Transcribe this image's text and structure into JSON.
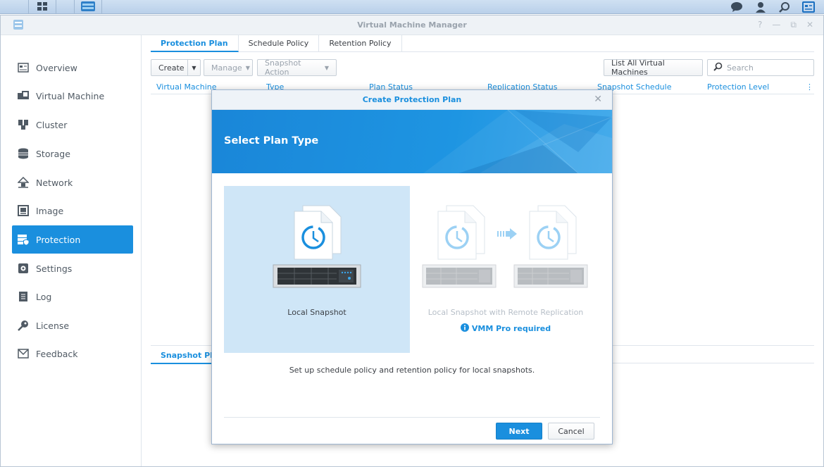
{
  "window": {
    "title": "Virtual Machine Manager"
  },
  "sidebar": {
    "items": [
      {
        "label": "Overview",
        "icon": "overview-icon"
      },
      {
        "label": "Virtual Machine",
        "icon": "virtual-machine-icon"
      },
      {
        "label": "Cluster",
        "icon": "cluster-icon"
      },
      {
        "label": "Storage",
        "icon": "storage-icon"
      },
      {
        "label": "Network",
        "icon": "network-icon"
      },
      {
        "label": "Image",
        "icon": "image-icon"
      },
      {
        "label": "Protection",
        "icon": "protection-icon",
        "active": true
      },
      {
        "label": "Settings",
        "icon": "settings-icon"
      },
      {
        "label": "Log",
        "icon": "log-icon"
      },
      {
        "label": "License",
        "icon": "license-icon"
      },
      {
        "label": "Feedback",
        "icon": "feedback-icon"
      }
    ]
  },
  "tabs": [
    "Protection Plan",
    "Schedule Policy",
    "Retention Policy"
  ],
  "toolbar": {
    "create": "Create",
    "manage": "Manage",
    "snapshot_action": "Snapshot Action",
    "list_all": "List All Virtual Machines",
    "search_placeholder": "Search"
  },
  "grid": {
    "columns": [
      "Virtual Machine",
      "Type",
      "Plan Status",
      "Replication Status",
      "Snapshot Schedule",
      "Protection Level"
    ]
  },
  "bottom_tab": "Snapshot Plan",
  "modal": {
    "title": "Create Protection Plan",
    "heading": "Select Plan Type",
    "options": [
      {
        "label": "Local Snapshot",
        "selected": true
      },
      {
        "label": "Local Snapshot with Remote Replication",
        "note": "VMM Pro required"
      }
    ],
    "description": "Set up schedule policy and retention policy for local snapshots.",
    "next": "Next",
    "cancel": "Cancel"
  },
  "colors": {
    "accent": "#1a8fde",
    "selected_bg": "#cfe6f7"
  }
}
